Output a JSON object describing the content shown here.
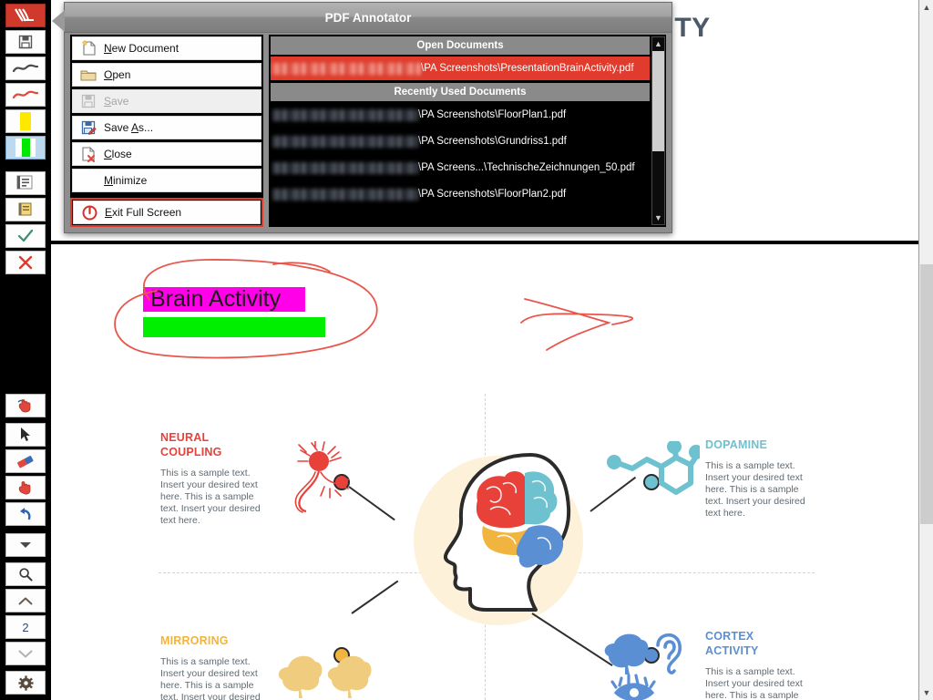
{
  "app": {
    "window_title": "PDF Annotator",
    "page_number_value": "2"
  },
  "toolbar": {
    "items": [
      {
        "name": "app-logo",
        "label": "PDF Annotator",
        "icon": "pen-logo-icon"
      },
      {
        "name": "save-tool",
        "label": "Save",
        "icon": "floppy-disk-icon"
      },
      {
        "name": "pen-black-tool",
        "label": "Black Pen",
        "icon": "pen-stroke-black-icon"
      },
      {
        "name": "pen-red-tool",
        "label": "Red Pen",
        "icon": "pen-stroke-red-icon"
      },
      {
        "name": "highlighter-yellow-tool",
        "label": "Yellow Highlighter",
        "icon": "highlighter-yellow-icon"
      },
      {
        "name": "highlighter-green-tool",
        "label": "Green Highlighter",
        "icon": "highlighter-green-icon"
      },
      {
        "name": "text-box-tool",
        "label": "Text Box",
        "icon": "text-box-icon"
      },
      {
        "name": "sticky-note-tool",
        "label": "Sticky Note",
        "icon": "sticky-note-icon"
      },
      {
        "name": "check-stamp-tool",
        "label": "Check Stamp",
        "icon": "check-icon"
      },
      {
        "name": "cross-stamp-tool",
        "label": "Cross Stamp",
        "icon": "cross-icon"
      }
    ],
    "bottom_items": [
      {
        "name": "hand-annotate-tool",
        "label": "Annotate Hand",
        "icon": "hand-pointing-icon"
      },
      {
        "name": "select-tool",
        "label": "Select",
        "icon": "cursor-arrow-icon"
      },
      {
        "name": "eraser-tool",
        "label": "Eraser",
        "icon": "eraser-icon"
      },
      {
        "name": "pan-tool",
        "label": "Pan",
        "icon": "hand-icon"
      },
      {
        "name": "undo-tool",
        "label": "Undo",
        "icon": "undo-arrow-icon"
      },
      {
        "name": "more-tools",
        "label": "More",
        "icon": "chevron-down-icon"
      },
      {
        "name": "zoom-tool",
        "label": "Zoom",
        "icon": "magnifier-icon"
      },
      {
        "name": "page-up",
        "label": "Previous Page",
        "icon": "chevron-up-icon"
      },
      {
        "name": "page-number",
        "label": "2",
        "icon": "page-number-field"
      },
      {
        "name": "page-down",
        "label": "Next Page",
        "icon": "chevron-down-icon"
      },
      {
        "name": "settings",
        "label": "Settings",
        "icon": "gear-icon"
      }
    ]
  },
  "menu": {
    "title": "PDF Annotator",
    "items": [
      {
        "label": "New Document",
        "accel": "N",
        "icon": "new-document-icon",
        "disabled": false,
        "has_icon": true
      },
      {
        "label": "Open",
        "accel": "O",
        "icon": "folder-open-icon",
        "disabled": false,
        "has_icon": true
      },
      {
        "label": "Save",
        "accel": "S",
        "icon": "floppy-disk-icon",
        "disabled": true,
        "has_icon": true
      },
      {
        "label": "Save As...",
        "accel": "A",
        "icon": "save-as-icon",
        "disabled": false,
        "has_icon": true
      },
      {
        "label": "Close",
        "accel": "C",
        "icon": "close-document-icon",
        "disabled": false,
        "has_icon": true
      },
      {
        "label": "Minimize",
        "accel": "M",
        "icon": "",
        "disabled": false,
        "has_icon": false
      },
      {
        "label": "Exit Full Screen",
        "accel": "E",
        "icon": "power-icon",
        "disabled": false,
        "has_icon": true
      }
    ],
    "open_documents_header": "Open Documents",
    "recently_used_header": "Recently Used Documents",
    "open_documents": [
      {
        "path": "\\PA Screenshots\\PresentationBrainActivity.pdf",
        "active": true
      }
    ],
    "recent_documents": [
      {
        "path": "\\PA Screenshots\\FloorPlan1.pdf",
        "active": false
      },
      {
        "path": "\\PA Screenshots\\Grundriss1.pdf",
        "active": false
      },
      {
        "path": "\\PA Screens...\\TechnischeZeichnungen_50.pdf",
        "active": false
      },
      {
        "path": "\\PA Screenshots\\FloorPlan2.pdf",
        "active": false
      }
    ]
  },
  "document": {
    "title_partial": "VITY",
    "annotation_text": "Brain Activity",
    "sections": [
      {
        "key": "neural-coupling",
        "title_line1": "NEURAL",
        "title_line2": "COUPLING",
        "color": "#e8413a",
        "body": "This is a sample text. Insert your desired text here. This is a sample text. Insert your desired text here."
      },
      {
        "key": "dopamine",
        "title_line1": "DOPAMINE",
        "title_line2": "",
        "color": "#6ec1ce",
        "body": "This is a sample text. Insert your desired text here. This is a sample text. Insert your desired text here."
      },
      {
        "key": "mirroring",
        "title_line1": "MIRRORING",
        "title_line2": "",
        "color": "#f0b43f",
        "body": "This is a sample text. Insert your desired text here. This is a sample text. Insert your desired"
      },
      {
        "key": "cortex-activity",
        "title_line1": "CORTEX",
        "title_line2": "ACTIVITY",
        "color": "#5b8fd4",
        "body": "This is a sample text. Insert your desired text here. This is a sample"
      }
    ]
  },
  "colors": {
    "accent_red": "#cf3a2c",
    "highlight_magenta": "#ff00e8",
    "highlight_green": "#00ef00",
    "ink_red": "#e8564c",
    "brain_red": "#e8413a",
    "brain_teal": "#6ec1ce",
    "brain_yellow": "#f0b43f",
    "brain_blue": "#5b8fd4"
  }
}
